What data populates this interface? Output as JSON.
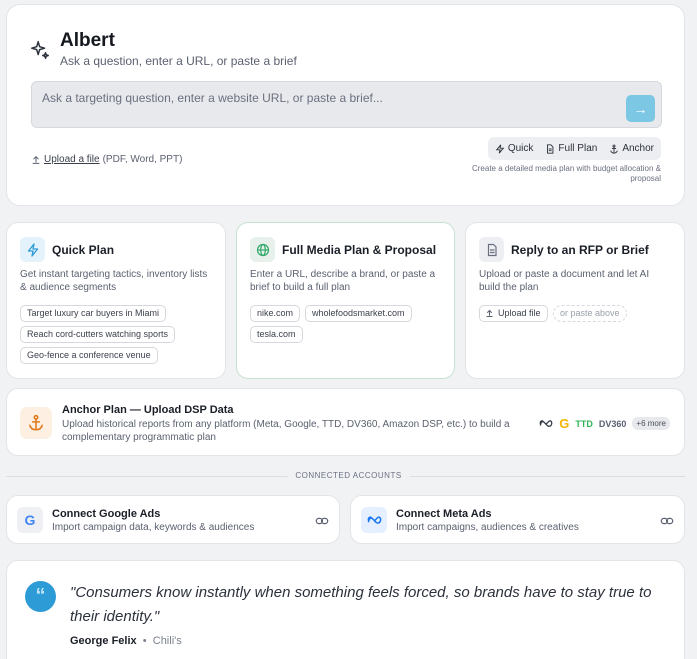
{
  "hero": {
    "title": "Albert",
    "subtitle": "Ask a question, enter a URL, or paste a brief",
    "input_placeholder": "Ask a targeting question, enter a website URL, or paste a brief...",
    "upload_link": "Upload a file",
    "upload_formats": "(PDF, Word, PPT)",
    "modes": [
      {
        "label": "Quick",
        "icon": "bolt-icon"
      },
      {
        "label": "Full Plan",
        "icon": "document-icon"
      },
      {
        "label": "Anchor",
        "icon": "anchor-icon"
      }
    ],
    "hint": "Create a detailed media plan with budget allocation & proposal"
  },
  "options": [
    {
      "title": "Quick Plan",
      "description": "Get instant targeting tactics, inventory lists & audience segments",
      "chips": [
        "Target luxury car buyers in Miami",
        "Reach cord-cutters watching sports",
        "Geo-fence a conference venue"
      ],
      "icon": "bolt-icon",
      "accent": "#2d9bd6"
    },
    {
      "title": "Full Media Plan & Proposal",
      "description": "Enter a URL, describe a brand, or paste a brief to build a full plan",
      "chips": [
        "nike.com",
        "wholefoodsmarket.com",
        "tesla.com"
      ],
      "icon": "globe-icon",
      "accent": "#2fa86a"
    },
    {
      "title": "Reply to an RFP or Brief",
      "description": "Upload or paste a document and let AI build the plan",
      "chips": [
        "Upload file",
        "or paste above"
      ],
      "icon": "document-icon",
      "accent": "#6b7080"
    }
  ],
  "anchor": {
    "title": "Anchor Plan — Upload DSP Data",
    "description": "Upload historical reports from any platform (Meta, Google, TTD, DV360, Amazon DSP, etc.) to build a complementary programmatic plan",
    "platforms": [
      "TTD",
      "DV360"
    ],
    "more": "+6 more",
    "icon": "anchor-icon",
    "accent": "#e07a1f"
  },
  "connected": {
    "label": "CONNECTED ACCOUNTS",
    "accounts": [
      {
        "title": "Connect Google Ads",
        "description": "Import campaign data, keywords & audiences",
        "icon": "google-icon"
      },
      {
        "title": "Connect Meta Ads",
        "description": "Import campaigns, audiences & creatives",
        "icon": "meta-icon"
      }
    ]
  },
  "quote": {
    "text": "\"Consumers know instantly when something feels forced, so brands have to stay true to their identity.\"",
    "author": "George Felix",
    "company": "Chili's",
    "separator": "•"
  }
}
